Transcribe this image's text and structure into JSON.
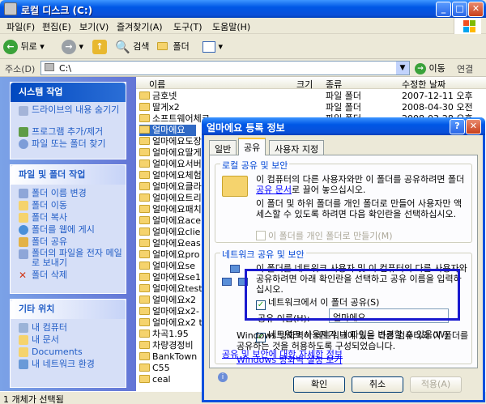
{
  "window": {
    "title": "로컬 디스크 (C:)"
  },
  "menu": [
    "파일(F)",
    "편집(E)",
    "보기(V)",
    "즐겨찾기(A)",
    "도구(T)",
    "도움말(H)"
  ],
  "toolbar": {
    "back": "뒤로",
    "search": "검색",
    "folders": "폴더"
  },
  "address": {
    "label": "주소(D)",
    "value": "C:\\",
    "go": "이동",
    "links": "연결"
  },
  "tasks": {
    "system": {
      "title": "시스템 작업",
      "items": [
        "드라이브의 내용 숨기기",
        "프로그램 추가/제거",
        "파일 또는 폴더 찾기"
      ]
    },
    "file": {
      "title": "파일 및 폴더 작업",
      "items": [
        "폴더 이름 변경",
        "폴더 이동",
        "폴더 복사",
        "폴더를 웹에 게시",
        "폴더 공유",
        "폴더의 파일을 전자 메일로 보내기",
        "폴더 삭제"
      ]
    },
    "other": {
      "title": "기타 위치",
      "items": [
        "내 컴퓨터",
        "내 문서",
        "Documents",
        "내 네트워크 환경"
      ]
    }
  },
  "list": {
    "columns": [
      "이름",
      "크기",
      "종류",
      "수정한 날짜"
    ],
    "rows": [
      {
        "name": "금호넷",
        "type": "파일 폴더",
        "date": "2007-12-11 오후"
      },
      {
        "name": "딸게x2",
        "type": "파일 폴더",
        "date": "2008-04-30 오전"
      },
      {
        "name": "소프트웨어체크",
        "type": "파일 폴더",
        "date": "2008-03-28 오후"
      },
      {
        "name": "얼마에요",
        "type": "",
        "date": ""
      },
      {
        "name": "얼마에요도장",
        "type": "",
        "date": ""
      },
      {
        "name": "얼마에요딸게",
        "type": "",
        "date": ""
      },
      {
        "name": "얼마에요서버",
        "type": "",
        "date": ""
      },
      {
        "name": "얼마에요체험",
        "type": "",
        "date": ""
      },
      {
        "name": "얼마에요클라",
        "type": "",
        "date": ""
      },
      {
        "name": "얼마에요트리",
        "type": "",
        "date": ""
      },
      {
        "name": "얼마에요패치",
        "type": "",
        "date": ""
      },
      {
        "name": "얼마에요ace",
        "type": "",
        "date": ""
      },
      {
        "name": "얼마에요clie",
        "type": "",
        "date": ""
      },
      {
        "name": "얼마에요eas",
        "type": "",
        "date": ""
      },
      {
        "name": "얼마에요pro",
        "type": "",
        "date": ""
      },
      {
        "name": "얼마에요se",
        "type": "",
        "date": ""
      },
      {
        "name": "얼마에요se1",
        "type": "",
        "date": ""
      },
      {
        "name": "얼마에요test",
        "type": "",
        "date": ""
      },
      {
        "name": "얼마에요x2",
        "type": "",
        "date": ""
      },
      {
        "name": "얼마에요x2-",
        "type": "",
        "date": ""
      },
      {
        "name": "얼마에요x2 t",
        "type": "",
        "date": ""
      },
      {
        "name": "차곡1.95",
        "type": "",
        "date": ""
      },
      {
        "name": "차량경정비",
        "type": "",
        "date": ""
      },
      {
        "name": "BankTown",
        "type": "",
        "date": ""
      },
      {
        "name": "C55",
        "type": "",
        "date": ""
      },
      {
        "name": "ceal",
        "type": "",
        "date": ""
      }
    ]
  },
  "status": {
    "text": "1 개체가 선택됨"
  },
  "dialog": {
    "title": "얼마에요 등록 정보",
    "tabs": [
      "일반",
      "공유",
      "사용자 지정"
    ],
    "local_group": "로컬 공유 및 보안",
    "local_text1_a": "이 컴퓨터의 다른 사용자와만 이 폴더를 공유하려면 폴더",
    "local_text1_link": "공유 문서",
    "local_text1_b": "로 끌어 놓으십시오.",
    "local_text2": "이 폴더 및 하위 폴더를 개인 폴더로 만들어 사용자만 액세스할 수 있도록 하려면 다음 확인란을 선택하십시오.",
    "private_checkbox": "이 폴더를 개인 폴더로 만들기(M)",
    "net_group": "네트워크 공유 및 보안",
    "net_text": "이 폴더를 네트워크 사용자 및 이 컴퓨터의 다른 사용자와 공유하려면 아래 확인란을 선택하고 공유 이름을 입력하십시오.",
    "share_checkbox": "네트워크에서 이 폴더 공유(S)",
    "share_name_label": "공유 이름(H):",
    "share_name_value": "얼마에요",
    "allow_change_checkbox": "네트워크 사용자가 내 파일을 변경할 수 있음(W)",
    "learn_link": "공유 및 보안에 대한 자세한 정보",
    "firewall_text": "Windows 방화벽이 네트워크에 있는 다른 컴퓨터와 이 폴더를 공유하는 것을 허용하도록 구성되었습니다.",
    "firewall_link": "Windows 방화벽 설정 보기",
    "ok": "확인",
    "cancel": "취소",
    "apply": "적용(A)"
  }
}
